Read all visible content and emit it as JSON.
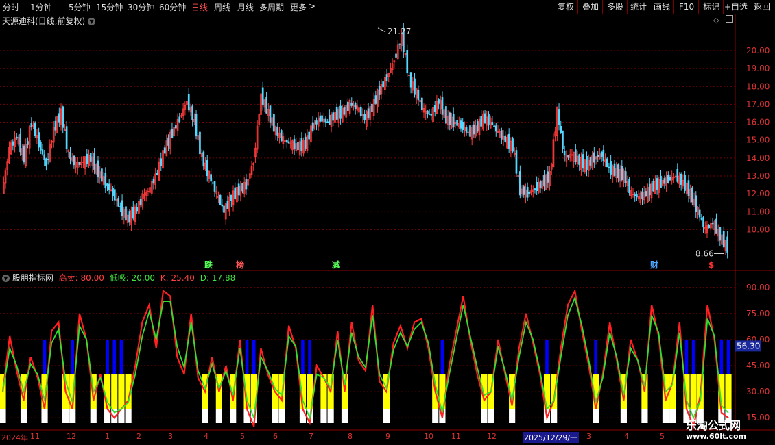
{
  "toolbar": {
    "periods": [
      "分时",
      "1分钟",
      "5分钟",
      "15分钟",
      "30分钟",
      "60分钟",
      "日线",
      "周线",
      "月线",
      "多周期",
      "更多"
    ],
    "active_period": "日线",
    "more_arrow": ">",
    "right_buttons": [
      "复权",
      "叠加",
      "多股",
      "统计",
      "画线",
      "F10",
      "标记",
      "+自选",
      "返回"
    ]
  },
  "main_panel": {
    "title": "天源迪科(日线,前复权)",
    "high_label": "21.27",
    "low_label": "8.66",
    "price_ticks": [
      "20.00",
      "19.00",
      "18.00",
      "17.00",
      "16.00",
      "15.00",
      "14.00",
      "13.00",
      "12.00",
      "11.00",
      "10.00"
    ],
    "events": [
      {
        "text": "跌",
        "color": "#55ff55"
      },
      {
        "text": "榜",
        "color": "#ff5555"
      },
      {
        "text": "减",
        "color": "#55ff55"
      },
      {
        "text": "财",
        "color": "#4da6ff"
      },
      {
        "text": "$",
        "color": "#ff3030"
      }
    ]
  },
  "indicator_panel": {
    "name": "股朋指标网",
    "high_sell_label": "高卖:",
    "high_sell_value": "80.00",
    "low_buy_label": "低吸:",
    "low_buy_value": "20.00",
    "k_label": "K:",
    "k_value": "25.40",
    "d_label": "D:",
    "d_value": "17.88",
    "ticks": [
      "90.00",
      "75.00",
      "60.00",
      "45.00",
      "30.00",
      "15.00"
    ],
    "cursor_value": "56.30"
  },
  "date_axis": [
    "2024年",
    "11",
    "12",
    "1",
    "2",
    "3",
    "4",
    "5",
    "6",
    "7",
    "8",
    "9",
    "10",
    "11",
    "12",
    "2025/12/29/一",
    "3",
    "4",
    "5"
  ],
  "watermark": {
    "line1": "乐淘公式网",
    "line2": "www.60lt.com"
  },
  "colors": {
    "up": "#ff3b3b",
    "down": "#54d8ff",
    "k_line": "#ff2020",
    "d_line": "#30e030",
    "yellow": "#ffff00",
    "blue": "#0000ff",
    "white": "#ffffff"
  },
  "chart_data": {
    "type": "line",
    "price": {
      "ylim": [
        8.6,
        21.3
      ],
      "closes": [
        12.0,
        14.5,
        15.2,
        14.0,
        16.0,
        14.8,
        13.6,
        15.6,
        16.5,
        14.2,
        13.6,
        13.8,
        14.0,
        13.2,
        12.6,
        12.0,
        11.2,
        10.6,
        11.0,
        11.8,
        12.3,
        13.2,
        14.5,
        15.4,
        16.2,
        17.2,
        16.0,
        14.0,
        13.0,
        12.0,
        11.0,
        11.8,
        12.2,
        12.5,
        13.8,
        17.5,
        16.5,
        15.5,
        15.0,
        14.8,
        14.6,
        14.8,
        15.8,
        16.2,
        16.0,
        16.4,
        16.5,
        17.0,
        16.8,
        16.2,
        16.8,
        17.8,
        18.5,
        19.5,
        20.8,
        18.4,
        17.6,
        16.6,
        16.4,
        17.2,
        16.2,
        16.0,
        15.8,
        15.4,
        15.6,
        16.2,
        16.0,
        15.4,
        15.0,
        14.6,
        12.2,
        12.0,
        12.3,
        12.6,
        13.0,
        16.6,
        14.0,
        14.2,
        13.8,
        13.6,
        14.0,
        14.2,
        13.4,
        13.2,
        13.0,
        12.0,
        11.8,
        12.0,
        12.4,
        12.6,
        12.8,
        13.0,
        12.6,
        12.0,
        11.0,
        10.0,
        10.4,
        9.6,
        9.0
      ],
      "high_point": {
        "value": 21.27
      },
      "low_point": {
        "value": 8.66
      }
    },
    "indicator": {
      "ylim": [
        8,
        97
      ],
      "levels": {
        "high_sell": 80,
        "low_buy": 20
      },
      "K": [
        30,
        62,
        42,
        25,
        50,
        38,
        20,
        65,
        70,
        30,
        20,
        75,
        60,
        25,
        40,
        20,
        15,
        20,
        25,
        45,
        70,
        80,
        55,
        88,
        85,
        50,
        40,
        75,
        38,
        30,
        50,
        30,
        45,
        25,
        60,
        20,
        10,
        55,
        40,
        30,
        25,
        68,
        55,
        20,
        12,
        45,
        38,
        30,
        65,
        30,
        70,
        48,
        42,
        80,
        36,
        30,
        58,
        68,
        55,
        70,
        72,
        55,
        30,
        15,
        45,
        65,
        85,
        60,
        40,
        25,
        30,
        60,
        40,
        22,
        55,
        75,
        58,
        40,
        15,
        25,
        55,
        80,
        88,
        65,
        45,
        20,
        40,
        70,
        48,
        25,
        60,
        48,
        30,
        80,
        62,
        25,
        35,
        70,
        20,
        10,
        28,
        80,
        60,
        18,
        15
      ],
      "D": [
        30,
        55,
        45,
        30,
        46,
        40,
        25,
        58,
        66,
        36,
        24,
        68,
        60,
        30,
        38,
        24,
        18,
        20,
        24,
        40,
        62,
        76,
        60,
        82,
        82,
        56,
        44,
        70,
        42,
        32,
        46,
        32,
        42,
        28,
        55,
        25,
        15,
        50,
        42,
        32,
        28,
        62,
        56,
        25,
        15,
        40,
        38,
        32,
        60,
        34,
        64,
        50,
        44,
        74,
        40,
        32,
        54,
        64,
        56,
        66,
        70,
        58,
        34,
        18,
        40,
        60,
        80,
        62,
        44,
        28,
        30,
        56,
        42,
        25,
        50,
        70,
        60,
        42,
        20,
        25,
        50,
        74,
        84,
        68,
        48,
        24,
        38,
        64,
        50,
        28,
        55,
        48,
        33,
        74,
        64,
        30,
        34,
        64,
        25,
        15,
        25,
        72,
        62,
        22,
        17.88
      ]
    }
  }
}
